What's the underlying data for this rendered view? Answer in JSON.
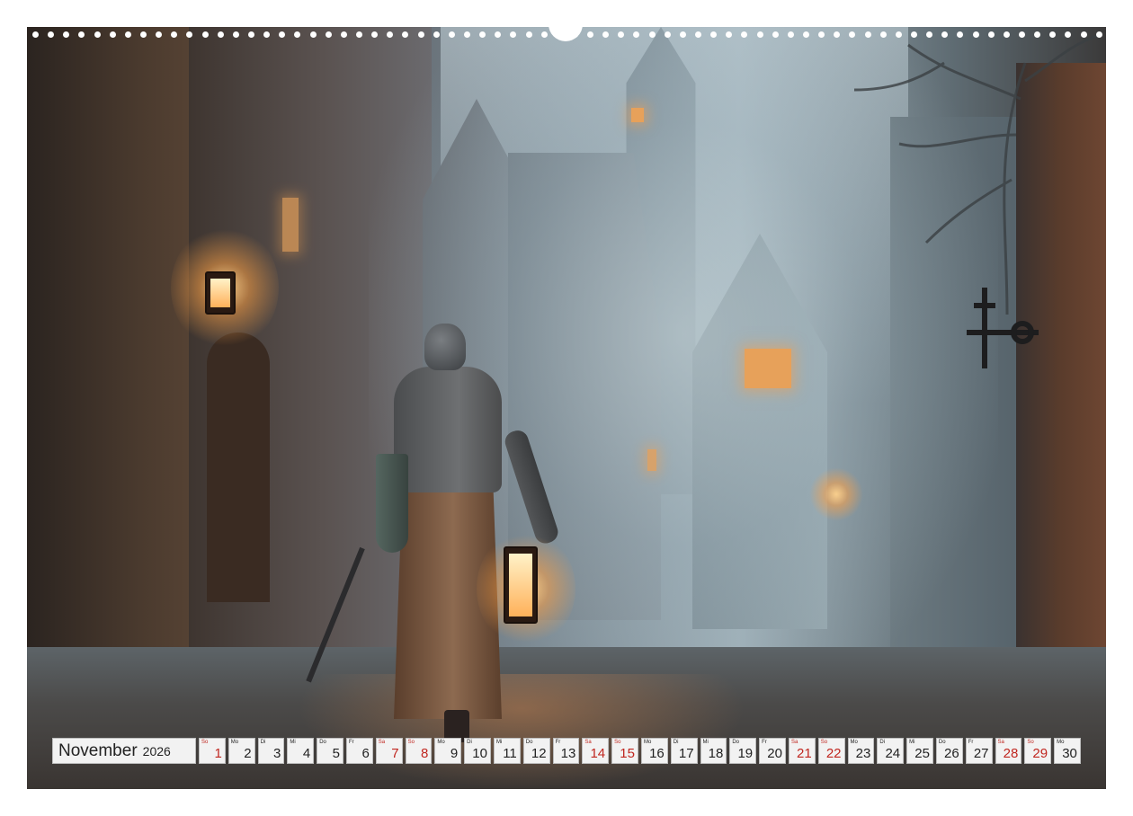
{
  "calendar": {
    "month": "November",
    "year": "2026",
    "days": [
      {
        "wd": "So",
        "n": "1",
        "weekend": true
      },
      {
        "wd": "Mo",
        "n": "2",
        "weekend": false
      },
      {
        "wd": "Di",
        "n": "3",
        "weekend": false
      },
      {
        "wd": "Mi",
        "n": "4",
        "weekend": false
      },
      {
        "wd": "Do",
        "n": "5",
        "weekend": false
      },
      {
        "wd": "Fr",
        "n": "6",
        "weekend": false
      },
      {
        "wd": "Sa",
        "n": "7",
        "weekend": true
      },
      {
        "wd": "So",
        "n": "8",
        "weekend": true
      },
      {
        "wd": "Mo",
        "n": "9",
        "weekend": false
      },
      {
        "wd": "Di",
        "n": "10",
        "weekend": false
      },
      {
        "wd": "Mi",
        "n": "11",
        "weekend": false
      },
      {
        "wd": "Do",
        "n": "12",
        "weekend": false
      },
      {
        "wd": "Fr",
        "n": "13",
        "weekend": false
      },
      {
        "wd": "Sa",
        "n": "14",
        "weekend": true
      },
      {
        "wd": "So",
        "n": "15",
        "weekend": true
      },
      {
        "wd": "Mo",
        "n": "16",
        "weekend": false
      },
      {
        "wd": "Di",
        "n": "17",
        "weekend": false
      },
      {
        "wd": "Mi",
        "n": "18",
        "weekend": false
      },
      {
        "wd": "Do",
        "n": "19",
        "weekend": false
      },
      {
        "wd": "Fr",
        "n": "20",
        "weekend": false
      },
      {
        "wd": "Sa",
        "n": "21",
        "weekend": true
      },
      {
        "wd": "So",
        "n": "22",
        "weekend": true
      },
      {
        "wd": "Mo",
        "n": "23",
        "weekend": false
      },
      {
        "wd": "Di",
        "n": "24",
        "weekend": false
      },
      {
        "wd": "Mi",
        "n": "25",
        "weekend": false
      },
      {
        "wd": "Do",
        "n": "26",
        "weekend": false
      },
      {
        "wd": "Fr",
        "n": "27",
        "weekend": false
      },
      {
        "wd": "Sa",
        "n": "28",
        "weekend": true
      },
      {
        "wd": "So",
        "n": "29",
        "weekend": true
      },
      {
        "wd": "Mo",
        "n": "30",
        "weekend": false
      }
    ]
  },
  "colors": {
    "weekend": "#c0261f",
    "cell_bg": "#f2f2f2",
    "lamp_glow": "#e7a15a"
  },
  "icons": [
    "binding-hole-icon",
    "hanger-notch-icon"
  ]
}
